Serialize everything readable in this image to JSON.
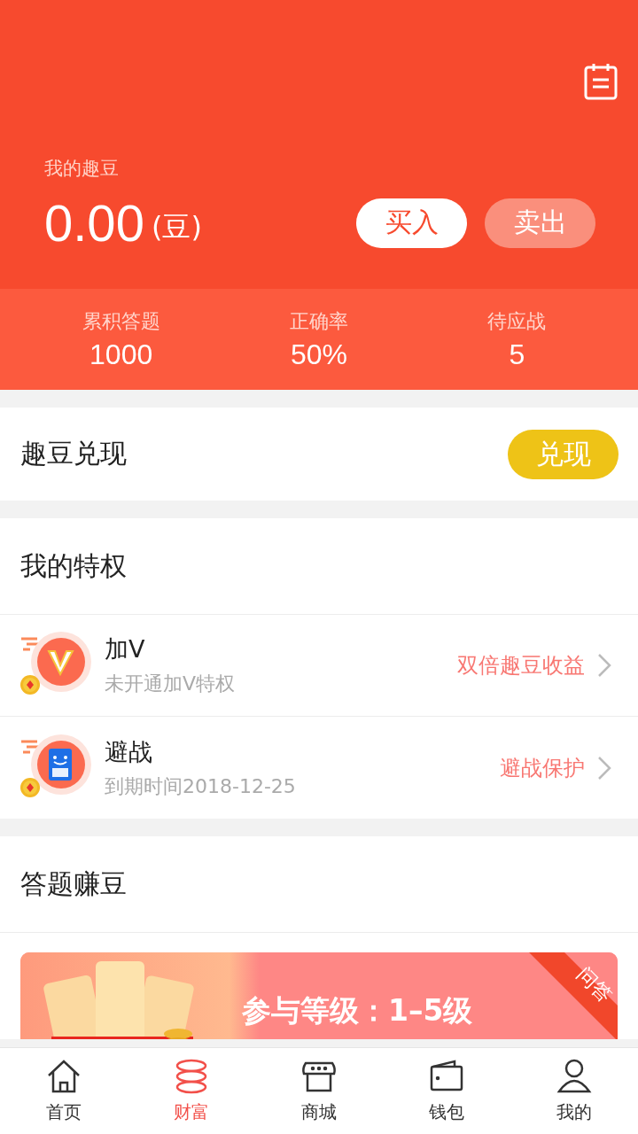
{
  "header": {
    "label": "我的趣豆",
    "amount": "0.00",
    "unit": "(豆)",
    "buttons": [
      {
        "label": "买入",
        "kind": "primary"
      },
      {
        "label": "卖出",
        "kind": "secondary"
      }
    ]
  },
  "stats": [
    {
      "label": "累积答题",
      "value": "1000"
    },
    {
      "label": "正确率",
      "value": "50%"
    },
    {
      "label": "待应战",
      "value": "5"
    }
  ],
  "exchange": {
    "title": "趣豆兑现",
    "button": "兑现"
  },
  "privileges": {
    "title": "我的特权",
    "items": [
      {
        "kind": "vip",
        "name": "加V",
        "detail": "未开通加V特权",
        "benefit": "双倍趣豆收益"
      },
      {
        "kind": "avoid",
        "name": "避战",
        "detail": "到期时间2018-12-25",
        "benefit": "避战保护"
      }
    ]
  },
  "earn": {
    "title": "答题赚豆",
    "banner": {
      "text": "参与等级：1–5级",
      "ribbon": "问答"
    }
  },
  "tabs": [
    {
      "label": "首页",
      "selected": false
    },
    {
      "label": "财富",
      "selected": true
    },
    {
      "label": "商城",
      "selected": false
    },
    {
      "label": "钱包",
      "selected": false
    },
    {
      "label": "我的",
      "selected": false
    }
  ]
}
